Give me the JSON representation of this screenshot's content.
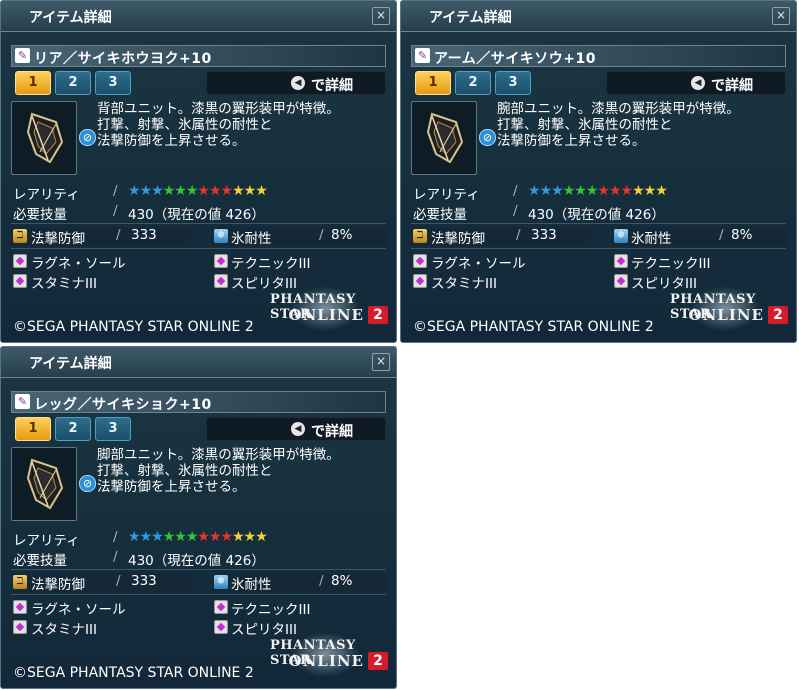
{
  "panels": [
    {
      "window_title": "アイテム詳細",
      "item_name": "リア／サイキホウヨク+10",
      "tabs": [
        "1",
        "2",
        "3"
      ],
      "detail_label": "で詳細",
      "description": [
        "背部ユニット。漆黒の翼形装甲が特徴。",
        "打撃、射撃、氷属性の耐性と",
        "法撃防御を上昇させる。"
      ],
      "rarity_label": "レアリティ",
      "required_label": "必要技量",
      "required_value": "430（現在の値 426）",
      "stat1_name": "法撃防御",
      "stat1_value": "333",
      "stat2_name": "氷耐性",
      "stat2_value": "8%",
      "abilities": [
        "ラグネ・ソール",
        "テクニックIII",
        "スタミナIII",
        "スピリタIII"
      ],
      "logo_line1": "PHANTASY STAR",
      "logo_line2": "ONLINE",
      "logo_number": "2",
      "copyright": "©SEGA PHANTASY STAR ONLINE 2"
    },
    {
      "window_title": "アイテム詳細",
      "item_name": "アーム／サイキソウ+10",
      "tabs": [
        "1",
        "2",
        "3"
      ],
      "detail_label": "で詳細",
      "description": [
        "腕部ユニット。漆黒の翼形装甲が特徴。",
        "打撃、射撃、氷属性の耐性と",
        "法撃防御を上昇させる。"
      ],
      "rarity_label": "レアリティ",
      "required_label": "必要技量",
      "required_value": "430（現在の値 426）",
      "stat1_name": "法撃防御",
      "stat1_value": "333",
      "stat2_name": "氷耐性",
      "stat2_value": "8%",
      "abilities": [
        "ラグネ・ソール",
        "テクニックIII",
        "スタミナIII",
        "スピリタIII"
      ],
      "logo_line1": "PHANTASY STAR",
      "logo_line2": "ONLINE",
      "logo_number": "2",
      "copyright": "©SEGA PHANTASY STAR ONLINE 2"
    },
    {
      "window_title": "アイテム詳細",
      "item_name": "レッグ／サイキショク+10",
      "tabs": [
        "1",
        "2",
        "3"
      ],
      "detail_label": "で詳細",
      "description": [
        "脚部ユニット。漆黒の翼形装甲が特徴。",
        "打撃、射撃、氷属性の耐性と",
        "法撃防御を上昇させる。"
      ],
      "rarity_label": "レアリティ",
      "required_label": "必要技量",
      "required_value": "430（現在の値 426）",
      "stat1_name": "法撃防御",
      "stat1_value": "333",
      "stat2_name": "氷耐性",
      "stat2_value": "8%",
      "abilities": [
        "ラグネ・ソール",
        "テクニックIII",
        "スタミナIII",
        "スピリタIII"
      ],
      "logo_line1": "PHANTASY STAR",
      "logo_line2": "ONLINE",
      "logo_number": "2",
      "copyright": "©SEGA PHANTASY STAR ONLINE 2"
    }
  ],
  "rarity_stars": 12,
  "rarity_star_colors": [
    "#2f9be6",
    "#2f9be6",
    "#2f9be6",
    "#34c43a",
    "#34c43a",
    "#34c43a",
    "#e8342c",
    "#e8342c",
    "#e8342c",
    "#f2d33a",
    "#f2d33a",
    "#f2d33a"
  ],
  "icons": {
    "category": "unit-icon",
    "detail_button": "controller-button-icon",
    "no_entry": "no-entry-icon",
    "stat1": "tech-defense-icon",
    "stat2": "ice-resistance-icon",
    "ability": "ability-icon"
  }
}
